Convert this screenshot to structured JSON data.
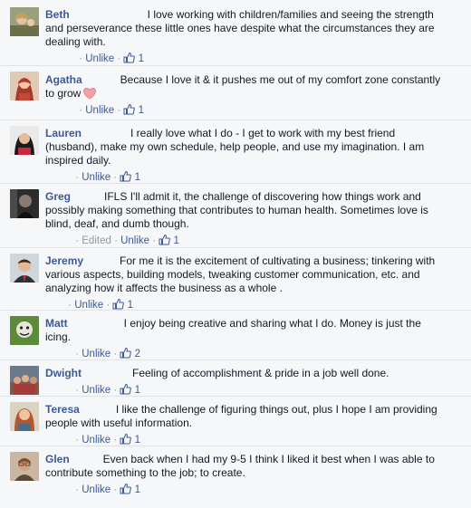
{
  "labels": {
    "unlike": "Unlike",
    "edited": "Edited",
    "sep": "·"
  },
  "colors": {
    "link": "#3b5998",
    "meta": "#9197a3",
    "heart": "#f2a0a8"
  },
  "comments": [
    {
      "author": "Beth",
      "avatar": "avatar-photo",
      "text": "I love working with children/families and seeing the strength and perseverance these little ones have despite what the circumstances they are dealing with.",
      "likes": "1"
    },
    {
      "author": "Agatha",
      "avatar": "avatar-photo",
      "text": "Because I love it & it pushes me out of my comfort zone constantly to grow",
      "icon": "heart-icon",
      "likes": "1"
    },
    {
      "author": "Lauren",
      "avatar": "avatar-photo",
      "text": "I really love what I do - I get to work with my best friend (husband), make my own schedule, help people, and use my imagination. I am inspired daily.",
      "likes": "1"
    },
    {
      "author": "Greg",
      "avatar": "avatar-photo",
      "text": "IFLS I'll admit it, the challenge of discovering how things work and possibly making something that contributes to human health. Sometimes love is blind, deaf, and dumb though.",
      "edited": true,
      "likes": "1"
    },
    {
      "author": "Jeremy",
      "avatar": "avatar-photo",
      "text": "For me it is the excitement of cultivating a business; tinkering with various aspects, building models, tweaking customer communication, etc. and analyzing how it affects the business as a whole .",
      "likes": "1"
    },
    {
      "author": "Matt",
      "avatar": "avatar-photo",
      "text": "I enjoy being creative and sharing what I do. Money is just the icing.",
      "likes": "2"
    },
    {
      "author": "Dwight",
      "avatar": "avatar-photo",
      "text": "Feeling of accomplishment & pride in a job well done.",
      "likes": "1"
    },
    {
      "author": "Teresa",
      "avatar": "avatar-photo",
      "text": "I like the challenge of figuring things out, plus I hope I am providing people with useful information.",
      "likes": "1"
    },
    {
      "author": "Glen",
      "avatar": "avatar-photo",
      "text": "Even back when I had my 9-5 I think I liked it best when I was able to contribute something to the job; to create.",
      "likes": "1"
    }
  ]
}
